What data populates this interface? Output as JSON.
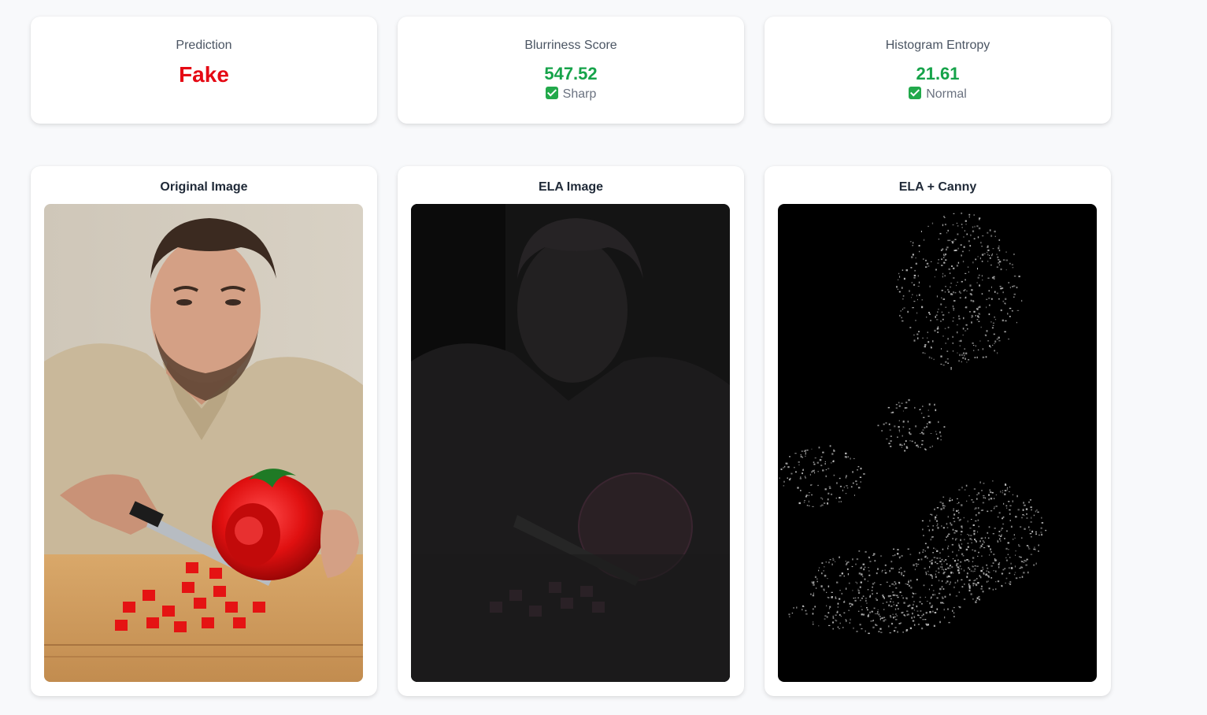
{
  "metrics": {
    "prediction": {
      "label": "Prediction",
      "value": "Fake",
      "value_color": "#e50914"
    },
    "blurriness": {
      "label": "Blurriness Score",
      "value": "547.52",
      "status": "Sharp",
      "status_icon": "check-mark-icon",
      "value_color": "#16a34a"
    },
    "entropy": {
      "label": "Histogram Entropy",
      "value": "21.61",
      "status": "Normal",
      "status_icon": "check-mark-icon",
      "value_color": "#16a34a"
    }
  },
  "images": {
    "original": {
      "title": "Original Image"
    },
    "ela": {
      "title": "ELA Image"
    },
    "ela_canny": {
      "title": "ELA + Canny"
    }
  }
}
